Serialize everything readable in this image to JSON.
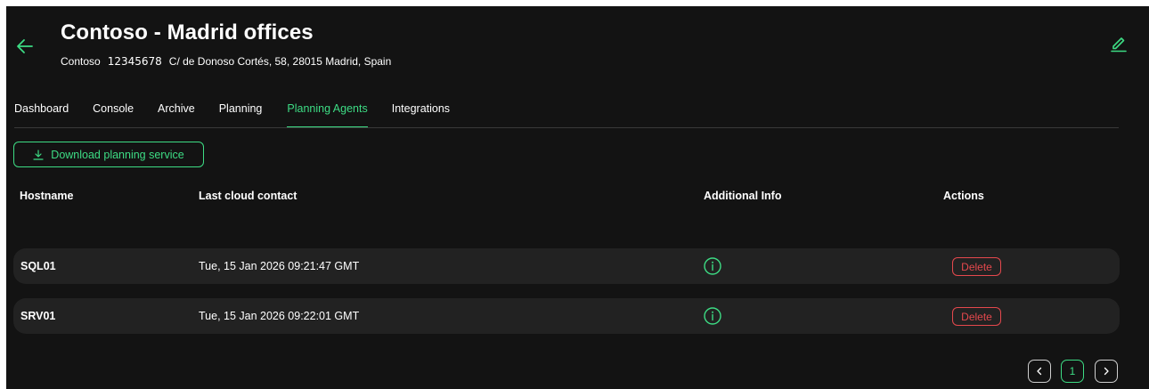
{
  "header": {
    "title": "Contoso - Madrid offices",
    "company": "Contoso",
    "id": "12345678",
    "address": "C/ de Donoso Cortés, 58, 28015 Madrid, Spain"
  },
  "tabs": [
    {
      "label": "Dashboard",
      "active": false
    },
    {
      "label": "Console",
      "active": false
    },
    {
      "label": "Archive",
      "active": false
    },
    {
      "label": "Planning",
      "active": false
    },
    {
      "label": "Planning Agents",
      "active": true
    },
    {
      "label": "Integrations",
      "active": false
    }
  ],
  "download_button": {
    "label": "Download planning service",
    "icon": "download-icon"
  },
  "table": {
    "columns": [
      "Hostname",
      "Last cloud contact",
      "Additional Info",
      "Actions"
    ],
    "rows": [
      {
        "hostname": "SQL01",
        "last_contact": "Tue, 15 Jan 2026 09:21:47 GMT",
        "action": "Delete"
      },
      {
        "hostname": "SRV01",
        "last_contact": "Tue, 15 Jan 2026 09:22:01 GMT",
        "action": "Delete"
      }
    ]
  },
  "pagination": {
    "current": "1",
    "prev_icon": "chevron-left-icon",
    "next_icon": "chevron-right-icon"
  },
  "colors": {
    "accent": "#3ddc84",
    "danger": "#e5484d",
    "background": "#131313",
    "row_background": "#222222"
  }
}
